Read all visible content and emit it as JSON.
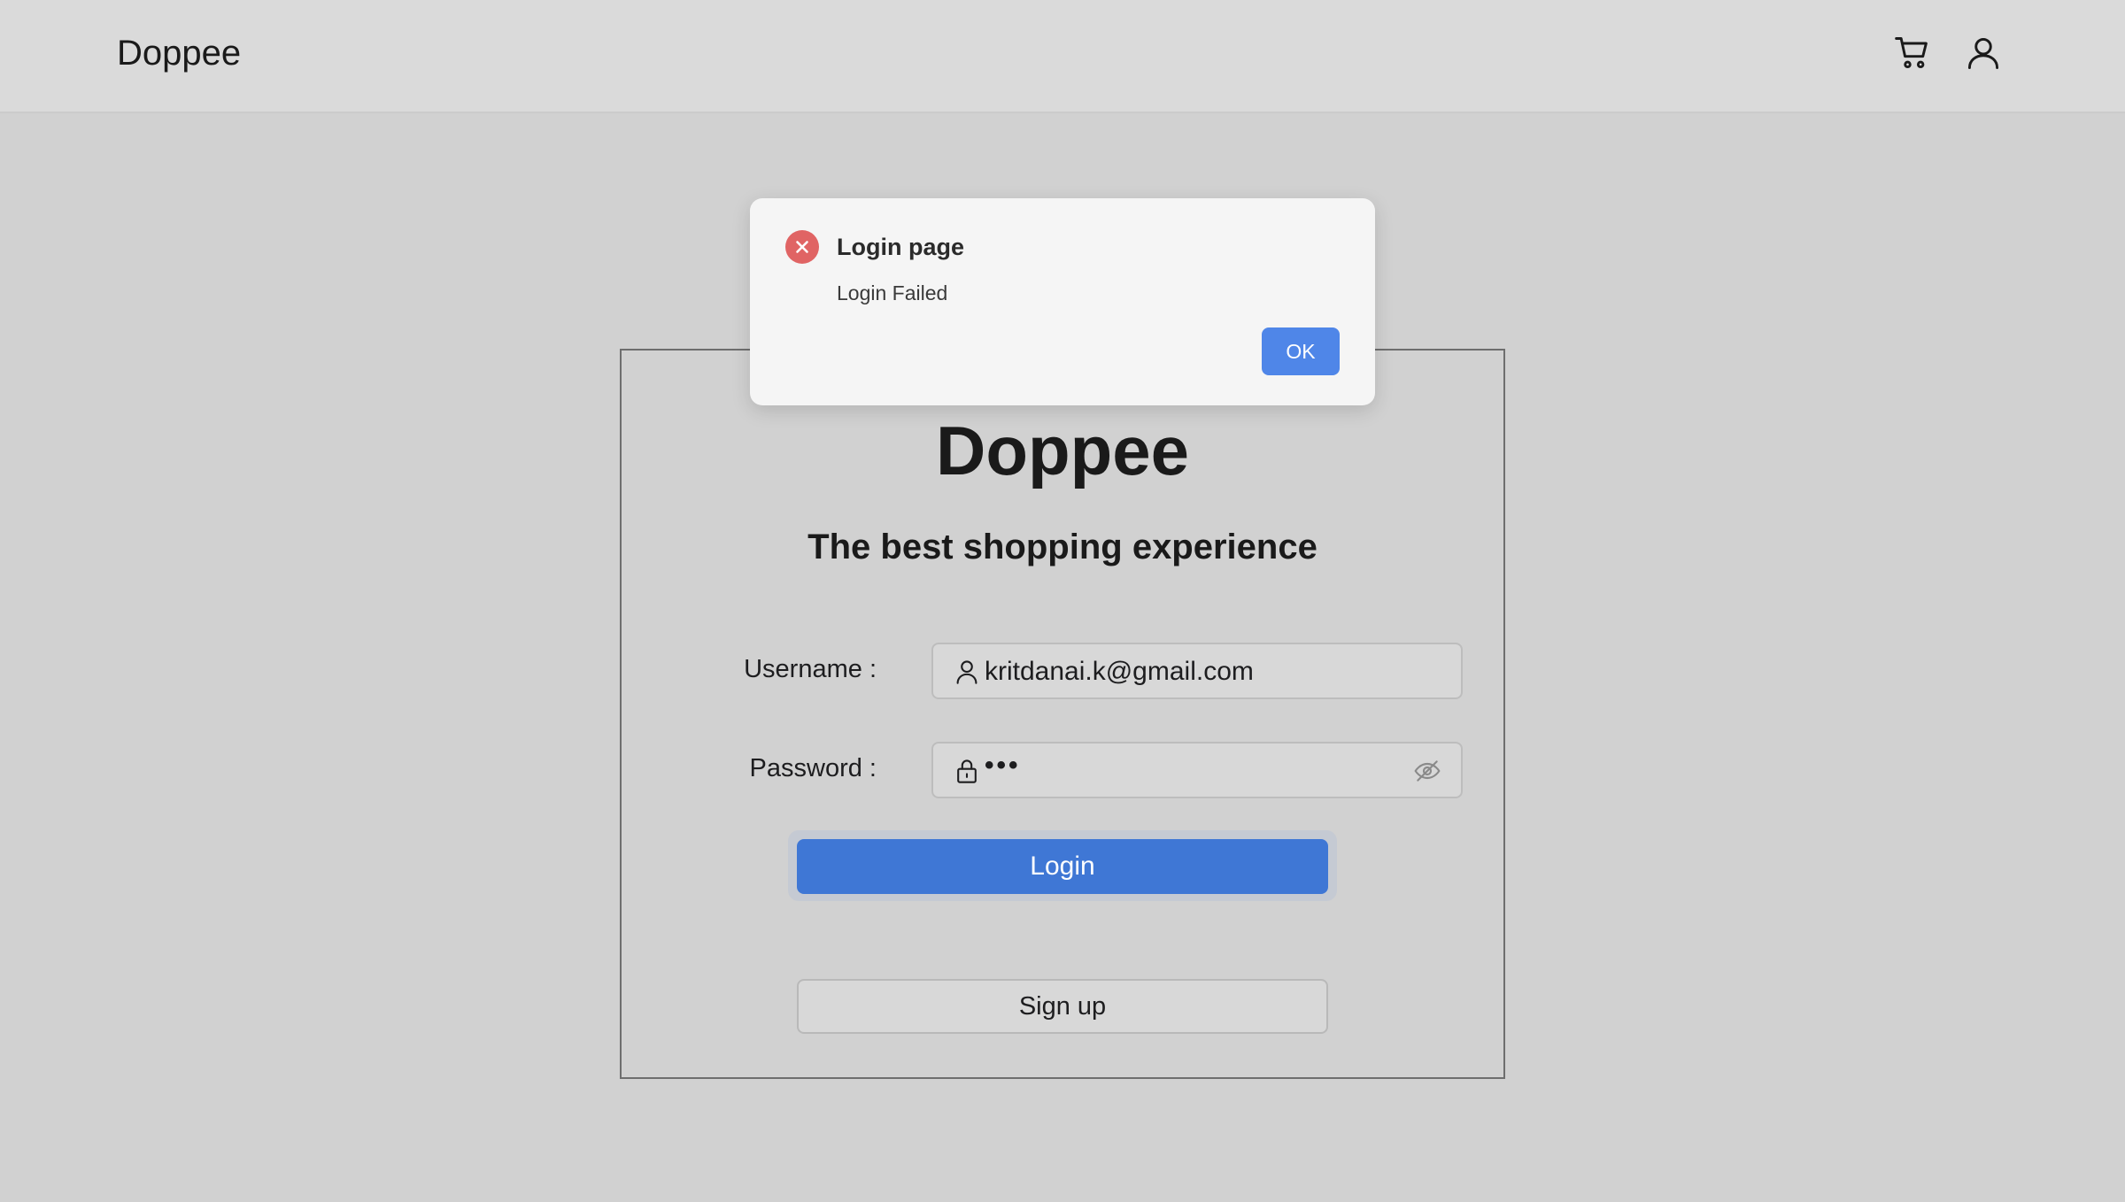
{
  "header": {
    "brand": "Doppee",
    "icons": [
      "cart-icon",
      "user-account-icon"
    ]
  },
  "login_card": {
    "title": "Doppee",
    "subtitle": "The best shopping experience",
    "username": {
      "label": "Username :",
      "value": "kritdanai.k@gmail.com",
      "icon": "user-icon"
    },
    "password": {
      "label": "Password :",
      "value": "•••",
      "icon": "lock-icon",
      "toggle_icon": "eye-hidden-icon"
    },
    "login_label": "Login",
    "signup_label": "Sign up"
  },
  "dialog": {
    "title": "Login page",
    "message": "Login Failed",
    "ok_label": "OK",
    "icon": "error-icon"
  },
  "colors": {
    "background": "#d1d1d1",
    "header": "#dadada",
    "primary": "#3f77d5",
    "ok_button": "#4f86e8",
    "error": "#e06464"
  }
}
